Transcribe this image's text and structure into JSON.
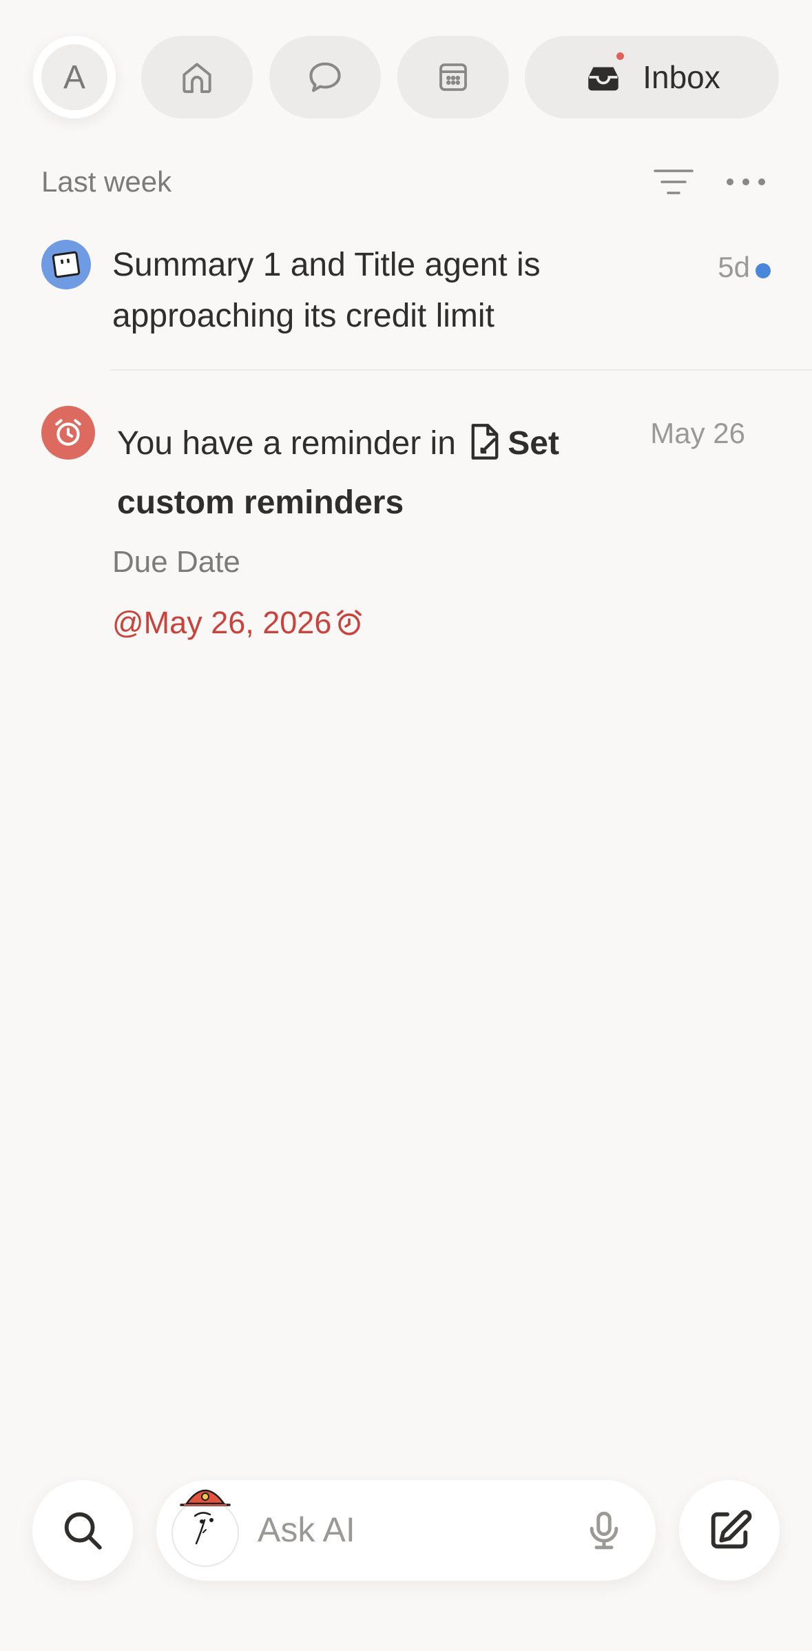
{
  "nav": {
    "avatar_initial": "A",
    "items": [
      {
        "name": "home",
        "icon": "home-icon"
      },
      {
        "name": "chat",
        "icon": "chat-bubble-icon"
      },
      {
        "name": "calendar",
        "icon": "calendar-icon"
      },
      {
        "name": "inbox",
        "icon": "inbox-tray-icon",
        "label": "Inbox",
        "has_notification_dot": true
      }
    ]
  },
  "section": {
    "title": "Last week",
    "actions": [
      "filter-icon",
      "more-icon"
    ]
  },
  "notifications": [
    {
      "icon": "agent-face-icon",
      "icon_color": "#6f9be3",
      "text": "Summary 1 and Title agent is approaching its credit limit",
      "time": "5d",
      "unread": true,
      "unread_color": "#4a86db"
    },
    {
      "icon": "alarm-clock-icon",
      "icon_color": "#dc6a5f",
      "text_prefix": "You have a reminder in",
      "page_icon": "page-link-icon",
      "page_title": "Set custom reminders",
      "time": "May 26",
      "property_label": "Due Date",
      "property_value": "@May 26, 2026",
      "property_color": "#c9423b"
    }
  ],
  "bottom": {
    "search_icon": "search-icon",
    "ask_placeholder": "Ask AI",
    "mic_icon": "mic-icon",
    "compose_icon": "compose-icon"
  },
  "colors": {
    "background": "#f9f8f7",
    "pill": "#ecebe9",
    "notification_dot": "#e16259"
  }
}
